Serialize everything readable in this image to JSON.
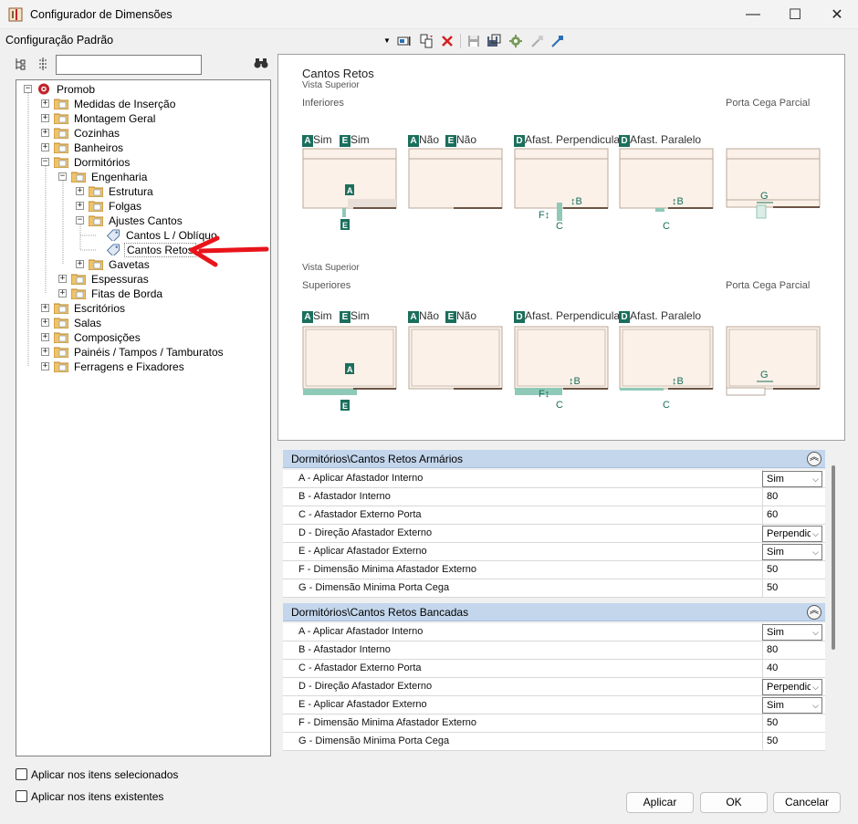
{
  "window": {
    "title": "Configurador de Dimensões",
    "minimize": "—",
    "maximize": "☐",
    "close": "✕"
  },
  "toolbar": {
    "config_label": "Configuração Padrão"
  },
  "tree": [
    {
      "label": "Promob"
    },
    {
      "label": "Medidas de Inserção"
    },
    {
      "label": "Montagem Geral"
    },
    {
      "label": "Cozinhas"
    },
    {
      "label": "Banheiros"
    },
    {
      "label": "Dormitórios"
    },
    {
      "label": "Engenharia"
    },
    {
      "label": "Estrutura"
    },
    {
      "label": "Folgas"
    },
    {
      "label": "Ajustes Cantos"
    },
    {
      "label": "Cantos L / Oblíquo"
    },
    {
      "label": "Cantos Retos"
    },
    {
      "label": "Gavetas"
    },
    {
      "label": "Espessuras"
    },
    {
      "label": "Fitas de Borda"
    },
    {
      "label": "Escritórios"
    },
    {
      "label": "Salas"
    },
    {
      "label": "Composições"
    },
    {
      "label": "Painéis / Tampos / Tamburatos"
    },
    {
      "label": "Ferragens e Fixadores"
    }
  ],
  "checks": {
    "apply_selected": "Aplicar nos itens selecionados",
    "apply_existing": "Aplicar nos itens existentes"
  },
  "preview": {
    "title": "Cantos Retos",
    "subtitle1": "Vista Superior",
    "section1": "Inferiores",
    "subtitle2": "Vista Superior",
    "section2": "Superiores",
    "porta_cega": "Porta Cega Parcial",
    "porta_cega2": "Porta Cega Parcial",
    "labels": {
      "a_sim": "Sim",
      "e_sim": "Sim",
      "a_nao": "Não",
      "e_nao": "Não",
      "d_perp": "Afast. Perpendicular",
      "d_paral": "Afast. Paralelo",
      "A": "A",
      "E": "E",
      "D": "D",
      "B": "B",
      "C": "C",
      "F": "F",
      "G": "G"
    }
  },
  "groups": [
    {
      "title": "Dormitórios\\Cantos Retos Armários",
      "rows": [
        {
          "name": "A - Aplicar Afastador Interno",
          "value": "Sim",
          "type": "select"
        },
        {
          "name": "B - Afastador Interno",
          "value": "80",
          "type": "text"
        },
        {
          "name": "C - Afastador Externo Porta",
          "value": "60",
          "type": "text"
        },
        {
          "name": "D - Direção Afastador Externo",
          "value": "Perpendic",
          "type": "select"
        },
        {
          "name": "E - Aplicar Afastador Externo",
          "value": "Sim",
          "type": "select"
        },
        {
          "name": "F - Dimensão Minima Afastador Externo",
          "value": "50",
          "type": "text"
        },
        {
          "name": "G - Dimensão Minima Porta Cega",
          "value": "50",
          "type": "text"
        }
      ]
    },
    {
      "title": "Dormitórios\\Cantos Retos Bancadas",
      "rows": [
        {
          "name": "A - Aplicar Afastador Interno",
          "value": "Sim",
          "type": "select"
        },
        {
          "name": "B - Afastador Interno",
          "value": "80",
          "type": "text"
        },
        {
          "name": "C - Afastador Externo Porta",
          "value": "40",
          "type": "text"
        },
        {
          "name": "D - Direção Afastador Externo",
          "value": "Perpendic",
          "type": "select"
        },
        {
          "name": "E - Aplicar Afastador Externo",
          "value": "Sim",
          "type": "select"
        },
        {
          "name": "F - Dimensão Minima Afastador Externo",
          "value": "50",
          "type": "text"
        },
        {
          "name": "G - Dimensão Minima Porta Cega",
          "value": "50",
          "type": "text"
        }
      ]
    }
  ],
  "buttons": {
    "apply": "Aplicar",
    "ok": "OK",
    "cancel": "Cancelar"
  },
  "colors": {
    "badge": "#1b6f5c",
    "group_header": "#c3d6ec",
    "annotation_arrow": "#e8141a",
    "cabinet_fill": "#fbf1e8"
  }
}
